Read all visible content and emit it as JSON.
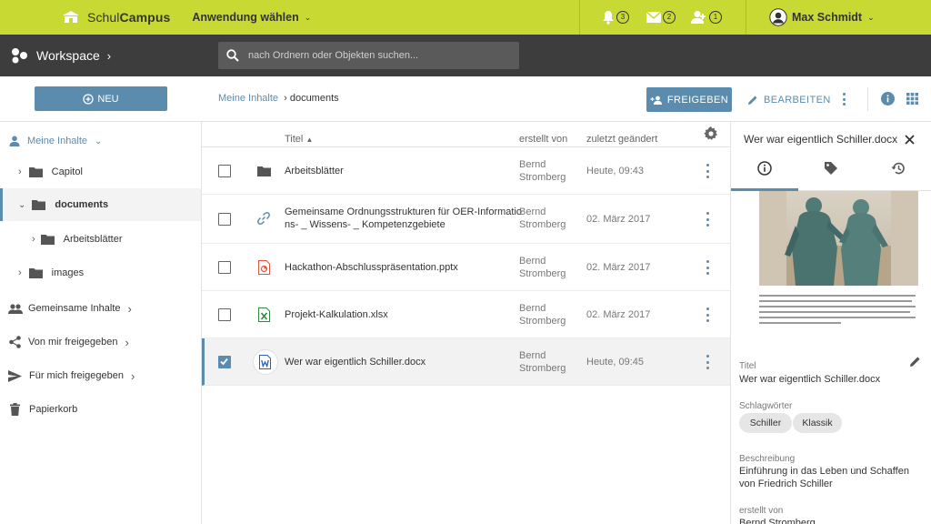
{
  "topbar": {
    "brand_light": "Schul",
    "brand_bold": "Campus",
    "app_select": "Anwendung wählen",
    "notifications": {
      "bell": "3",
      "mail": "2",
      "contacts": "1"
    },
    "user_name": "Max Schmidt"
  },
  "darkbar": {
    "workspace": "Workspace",
    "search_placeholder": "nach Ordnern oder Objekten suchen..."
  },
  "actionbar": {
    "new_label": "NEU",
    "breadcrumb_root": "Meine Inhalte",
    "breadcrumb_current": "› documents",
    "share_label": "FREIGEBEN",
    "edit_label": "BEARBEITEN"
  },
  "sidebar": {
    "my_content": "Meine Inhalte",
    "folders": [
      "Capitol",
      "documents",
      "Arbeitsblätter",
      "images"
    ],
    "shared": "Gemeinsame Inhalte",
    "shared_by_me": "Von mir freigegeben",
    "shared_with_me": "Für mich freigegeben",
    "trash": "Papierkorb"
  },
  "table": {
    "headers": {
      "title": "Titel",
      "created_by": "erstellt von",
      "modified": "zuletzt geändert"
    },
    "rows": [
      {
        "title": "Arbeitsblätter",
        "title2": "",
        "author1": "Bernd",
        "author2": "Stromberg",
        "date": "Heute, 09:43",
        "icon": "folder-icon",
        "checked": false
      },
      {
        "title": "Gemeinsame Ordnungsstrukturen für OER-Informatio",
        "title2": "ns- _ Wissens- _ Kompetenzgebiete",
        "author1": "Bernd",
        "author2": "Stromberg",
        "date": "02. März 2017",
        "icon": "link-icon",
        "checked": false
      },
      {
        "title": "Hackathon-Abschlusspräsentation.pptx",
        "title2": "",
        "author1": "Bernd",
        "author2": "Stromberg",
        "date": "02. März 2017",
        "icon": "powerpoint-file-icon",
        "checked": false
      },
      {
        "title": "Projekt-Kalkulation.xlsx",
        "title2": "",
        "author1": "Bernd",
        "author2": "Stromberg",
        "date": "02. März 2017",
        "icon": "excel-file-icon",
        "checked": false
      },
      {
        "title": "Wer war eigentlich Schiller.docx",
        "title2": "",
        "author1": "Bernd",
        "author2": "Stromberg",
        "date": "Heute, 09:45",
        "icon": "word-file-icon",
        "checked": true
      }
    ]
  },
  "details": {
    "header_title": "Wer war eigentlich Schiller.docx",
    "title_label": "Titel",
    "title_value": "Wer war eigentlich Schiller.docx",
    "tags_label": "Schlagwörter",
    "tags": [
      "Schiller",
      "Klassik"
    ],
    "description_label": "Beschreibung",
    "description_line1": "Einführung in das Leben und Schaffen",
    "description_line2": "von Friedrich Schiller",
    "created_by_label": "erstellt von",
    "created_by_value": "Bernd Stromberg"
  },
  "colors": {
    "brand_lime": "#c8d934",
    "accent_blue": "#5b8cad",
    "dark_bar": "#3d3d3d"
  }
}
